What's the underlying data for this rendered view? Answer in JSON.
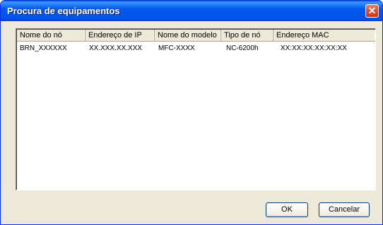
{
  "window": {
    "title": "Procura de equipamentos"
  },
  "list": {
    "columns": [
      "Nome do nó",
      "Endereço de IP",
      "Nome do modelo",
      "Tipo de nó",
      "Endereço MAC"
    ],
    "rows": [
      [
        "BRN_XXXXXX",
        "XX.XXX.XX.XXX",
        "MFC-XXXX",
        "NC-6200h",
        "XX:XX:XX:XX:XX:XX"
      ]
    ]
  },
  "buttons": {
    "ok_label": "OK",
    "cancel_label": "Cancelar"
  }
}
